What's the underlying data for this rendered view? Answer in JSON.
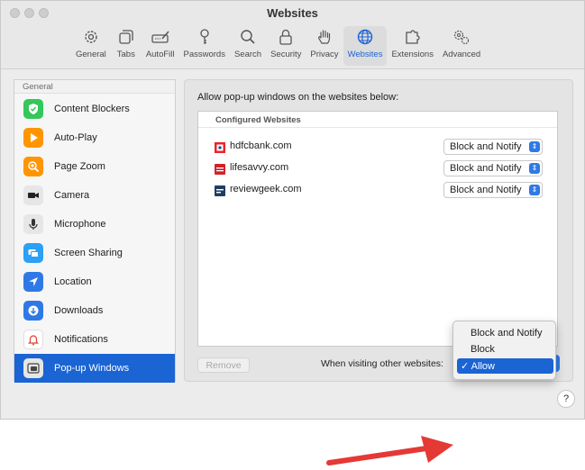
{
  "window": {
    "title": "Websites"
  },
  "toolbar": {
    "items": [
      {
        "label": "General",
        "icon": "gear-icon"
      },
      {
        "label": "Tabs",
        "icon": "tabs-icon"
      },
      {
        "label": "AutoFill",
        "icon": "autofill-icon"
      },
      {
        "label": "Passwords",
        "icon": "key-icon"
      },
      {
        "label": "Search",
        "icon": "search-icon"
      },
      {
        "label": "Security",
        "icon": "lock-icon"
      },
      {
        "label": "Privacy",
        "icon": "hand-icon"
      },
      {
        "label": "Websites",
        "icon": "globe-icon",
        "active": true
      },
      {
        "label": "Extensions",
        "icon": "puzzle-icon"
      },
      {
        "label": "Advanced",
        "icon": "gears-icon"
      }
    ]
  },
  "sidebar": {
    "section": "General",
    "items": [
      {
        "label": "Content Blockers",
        "icon": "shield-check-icon",
        "color": "#34c759"
      },
      {
        "label": "Auto-Play",
        "icon": "play-icon",
        "color": "#ff9500"
      },
      {
        "label": "Page Zoom",
        "icon": "zoom-icon",
        "color": "#ff9500"
      },
      {
        "label": "Camera",
        "icon": "camera-icon",
        "color": "#e6e6e6"
      },
      {
        "label": "Microphone",
        "icon": "microphone-icon",
        "color": "#e6e6e6"
      },
      {
        "label": "Screen Sharing",
        "icon": "screen-sharing-icon",
        "color": "#2ba0f5"
      },
      {
        "label": "Location",
        "icon": "location-arrow-icon",
        "color": "#2f79e6"
      },
      {
        "label": "Downloads",
        "icon": "download-icon",
        "color": "#2f79e6"
      },
      {
        "label": "Notifications",
        "icon": "bell-icon",
        "color": "#ffffff"
      },
      {
        "label": "Pop-up Windows",
        "icon": "popup-windows-icon",
        "color": "#e6e6e6",
        "selected": true
      }
    ]
  },
  "main": {
    "description": "Allow pop-up windows on the websites below:",
    "list_header": "Configured Websites",
    "sites": [
      {
        "name": "hdfcbank.com",
        "setting": "Block and Notify",
        "icon": "hdfc-favicon"
      },
      {
        "name": "lifesavvy.com",
        "setting": "Block and Notify",
        "icon": "lifesavvy-favicon"
      },
      {
        "name": "reviewgeek.com",
        "setting": "Block and Notify",
        "icon": "reviewgeek-favicon"
      }
    ],
    "remove_label": "Remove",
    "other_label": "When visiting other websites:"
  },
  "popup_menu": {
    "options": [
      "Block and Notify",
      "Block",
      "Allow"
    ],
    "selected": "Allow",
    "check_mark": "✓"
  },
  "help_label": "?",
  "colors": {
    "accent": "#1a64d4",
    "arrow": "#e53935"
  }
}
